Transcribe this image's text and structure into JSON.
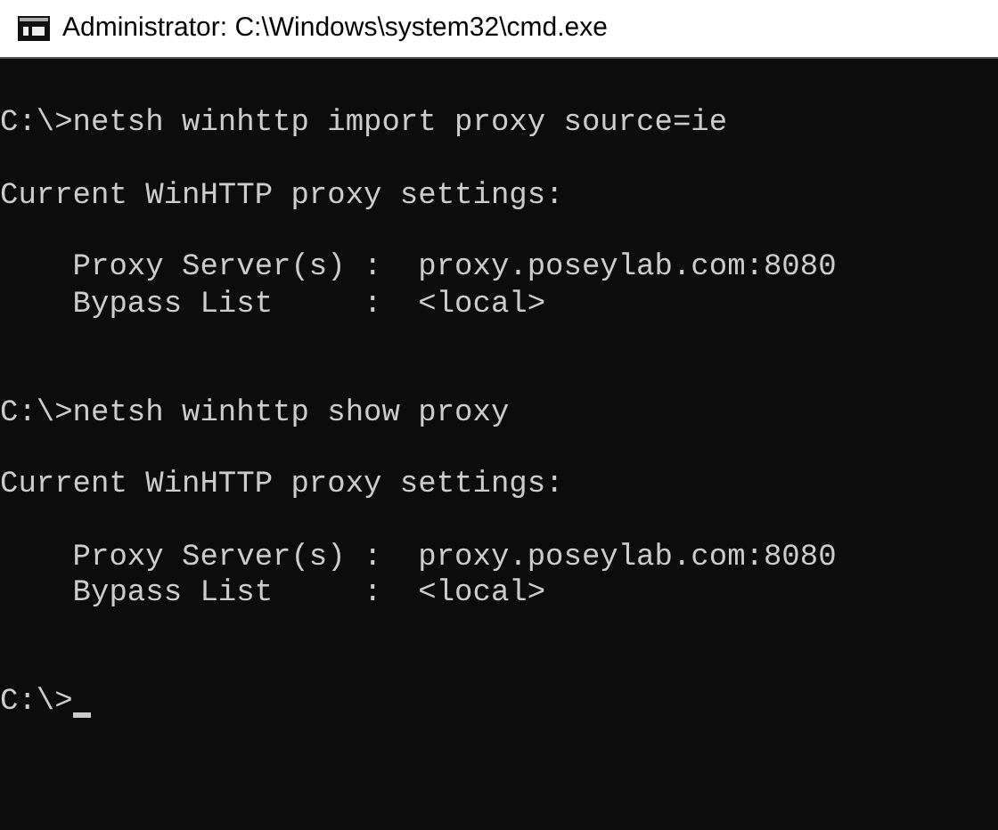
{
  "window": {
    "title": "Administrator: C:\\Windows\\system32\\cmd.exe"
  },
  "console": {
    "lines": [
      {
        "kind": "blank"
      },
      {
        "kind": "text",
        "text": "C:\\>netsh winhttp import proxy source=ie"
      },
      {
        "kind": "blank"
      },
      {
        "kind": "text",
        "text": "Current WinHTTP proxy settings:"
      },
      {
        "kind": "blank"
      },
      {
        "kind": "text",
        "text": "    Proxy Server(s) :  proxy.poseylab.com:8080"
      },
      {
        "kind": "text",
        "text": "    Bypass List     :  <local>"
      },
      {
        "kind": "blank"
      },
      {
        "kind": "blank"
      },
      {
        "kind": "text",
        "text": "C:\\>netsh winhttp show proxy"
      },
      {
        "kind": "blank"
      },
      {
        "kind": "text",
        "text": "Current WinHTTP proxy settings:"
      },
      {
        "kind": "blank"
      },
      {
        "kind": "text",
        "text": "    Proxy Server(s) :  proxy.poseylab.com:8080"
      },
      {
        "kind": "text",
        "text": "    Bypass List     :  <local>"
      },
      {
        "kind": "blank"
      },
      {
        "kind": "blank"
      },
      {
        "kind": "prompt",
        "text": "C:\\>"
      }
    ]
  }
}
